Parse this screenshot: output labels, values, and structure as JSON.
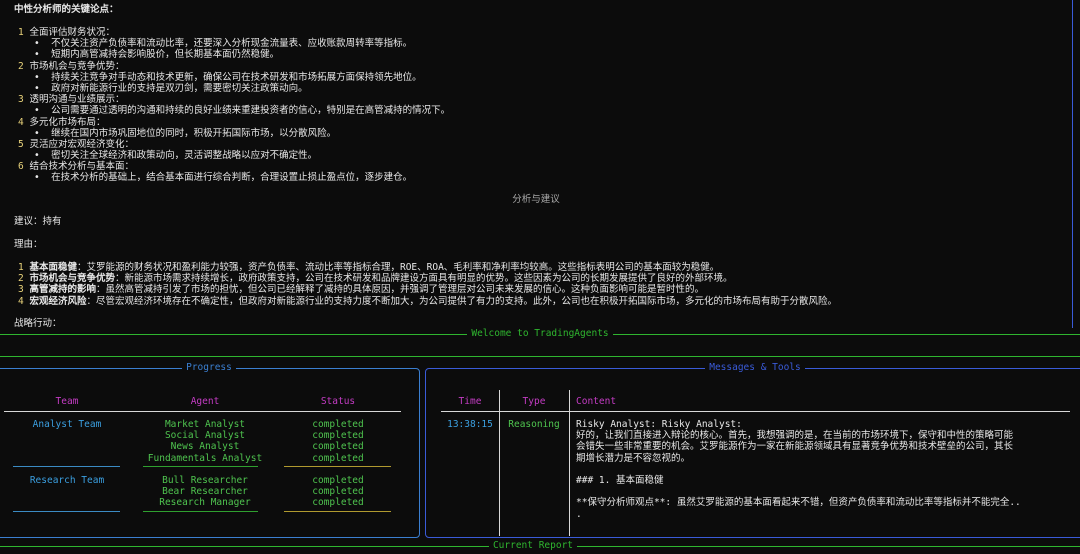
{
  "report": {
    "title": "中性分析师的关键论点：",
    "points": [
      {
        "num": "1",
        "heading": "全面评估财务状况：",
        "bullets": [
          "不仅关注资产负债率和流动比率，还要深入分析现金流量表、应收账款周转率等指标。",
          "短期内高管减持会影响股价，但长期基本面仍然稳健。"
        ]
      },
      {
        "num": "2",
        "heading": "市场机会与竞争优势：",
        "bullets": [
          "持续关注竞争对手动态和技术更新，确保公司在技术研发和市场拓展方面保持领先地位。",
          "政府对新能源行业的支持是双刃剑，需要密切关注政策动向。"
        ]
      },
      {
        "num": "3",
        "heading": "透明沟通与业绩展示：",
        "bullets": [
          "公司需要通过透明的沟通和持续的良好业绩来重建投资者的信心，特别是在高管减持的情况下。"
        ]
      },
      {
        "num": "4",
        "heading": "多元化市场布局：",
        "bullets": [
          "继续在国内市场巩固地位的同时，积极开拓国际市场，以分散风险。"
        ]
      },
      {
        "num": "5",
        "heading": "灵活应对宏观经济变化：",
        "bullets": [
          "密切关注全球经济和政策动向，灵活调整战略以应对不确定性。"
        ]
      },
      {
        "num": "6",
        "heading": "结合技术分析与基本面：",
        "bullets": [
          "在技术分析的基础上，结合基本面进行综合判断，合理设置止损止盈点位，逐步建仓。"
        ]
      }
    ],
    "section_heading": "分析与建议",
    "advice": "建议：持有",
    "reason_heading": "理由：",
    "reasons": [
      {
        "num": "1",
        "label": "基本面稳健",
        "text": "：艾罗能源的财务状况和盈利能力较强，资产负债率、流动比率等指标合理，ROE、ROA、毛利率和净利率均较高。这些指标表明公司的基本面较为稳健。"
      },
      {
        "num": "2",
        "label": "市场机会与竞争优势",
        "text": "：新能源市场需求持续增长，政府政策支持，公司在技术研发和品牌建设方面具有明显的优势。这些因素为公司的长期发展提供了良好的外部环境。"
      },
      {
        "num": "3",
        "label": "高管减持的影响",
        "text": "：虽然高管减持引发了市场的担忧，但公司已经解释了减持的具体原因，并强调了管理层对公司未来发展的信心。这种负面影响可能是暂时性的。"
      },
      {
        "num": "4",
        "label": "宏观经济风险",
        "text": "：尽管宏观经济环境存在不确定性，但政府对新能源行业的支持力度不断加大，为公司提供了有力的支持。此外，公司也在积极开拓国际市场，多元化的市场布局有助于分散风险。"
      }
    ],
    "strategy_heading": "战略行动："
  },
  "welcome_label": "Welcome to TradingAgents",
  "progress": {
    "title": "Progress",
    "headers": {
      "team": "Team",
      "agent": "Agent",
      "status": "Status"
    },
    "groups": [
      {
        "team": "Analyst Team",
        "rows": [
          {
            "agent": "Market Analyst",
            "status": "completed"
          },
          {
            "agent": "Social Analyst",
            "status": "completed"
          },
          {
            "agent": "News Analyst",
            "status": "completed"
          },
          {
            "agent": "Fundamentals Analyst",
            "status": "completed"
          }
        ]
      },
      {
        "team": "Research Team",
        "rows": [
          {
            "agent": "Bull Researcher",
            "status": "completed"
          },
          {
            "agent": "Bear Researcher",
            "status": "completed"
          },
          {
            "agent": "Research Manager",
            "status": "completed"
          }
        ]
      }
    ]
  },
  "messages": {
    "title": "Messages & Tools",
    "headers": {
      "time": "Time",
      "type": "Type",
      "content": "Content"
    },
    "row": {
      "time": "13:38:15",
      "type": "Reasoning",
      "content_lines": [
        "Risky Analyst: Risky Analyst:",
        "好的，让我们直接进入辩论的核心。首先，我想强调的是，在当前的市场环境下，保守和中性的策略可能",
        "会错失一些非常重要的机会。艾罗能源作为一家在新能源领域具有显著竞争优势和技术壁垒的公司，其长",
        "期增长潜力是不容忽视的。",
        "",
        "### 1. 基本面稳健",
        "",
        "**保守分析师观点**: 虽然艾罗能源的基本面看起来不错，但资产负债率和流动比率等指标并不能完全..",
        "."
      ]
    }
  },
  "current_report_label": "Current Report"
}
